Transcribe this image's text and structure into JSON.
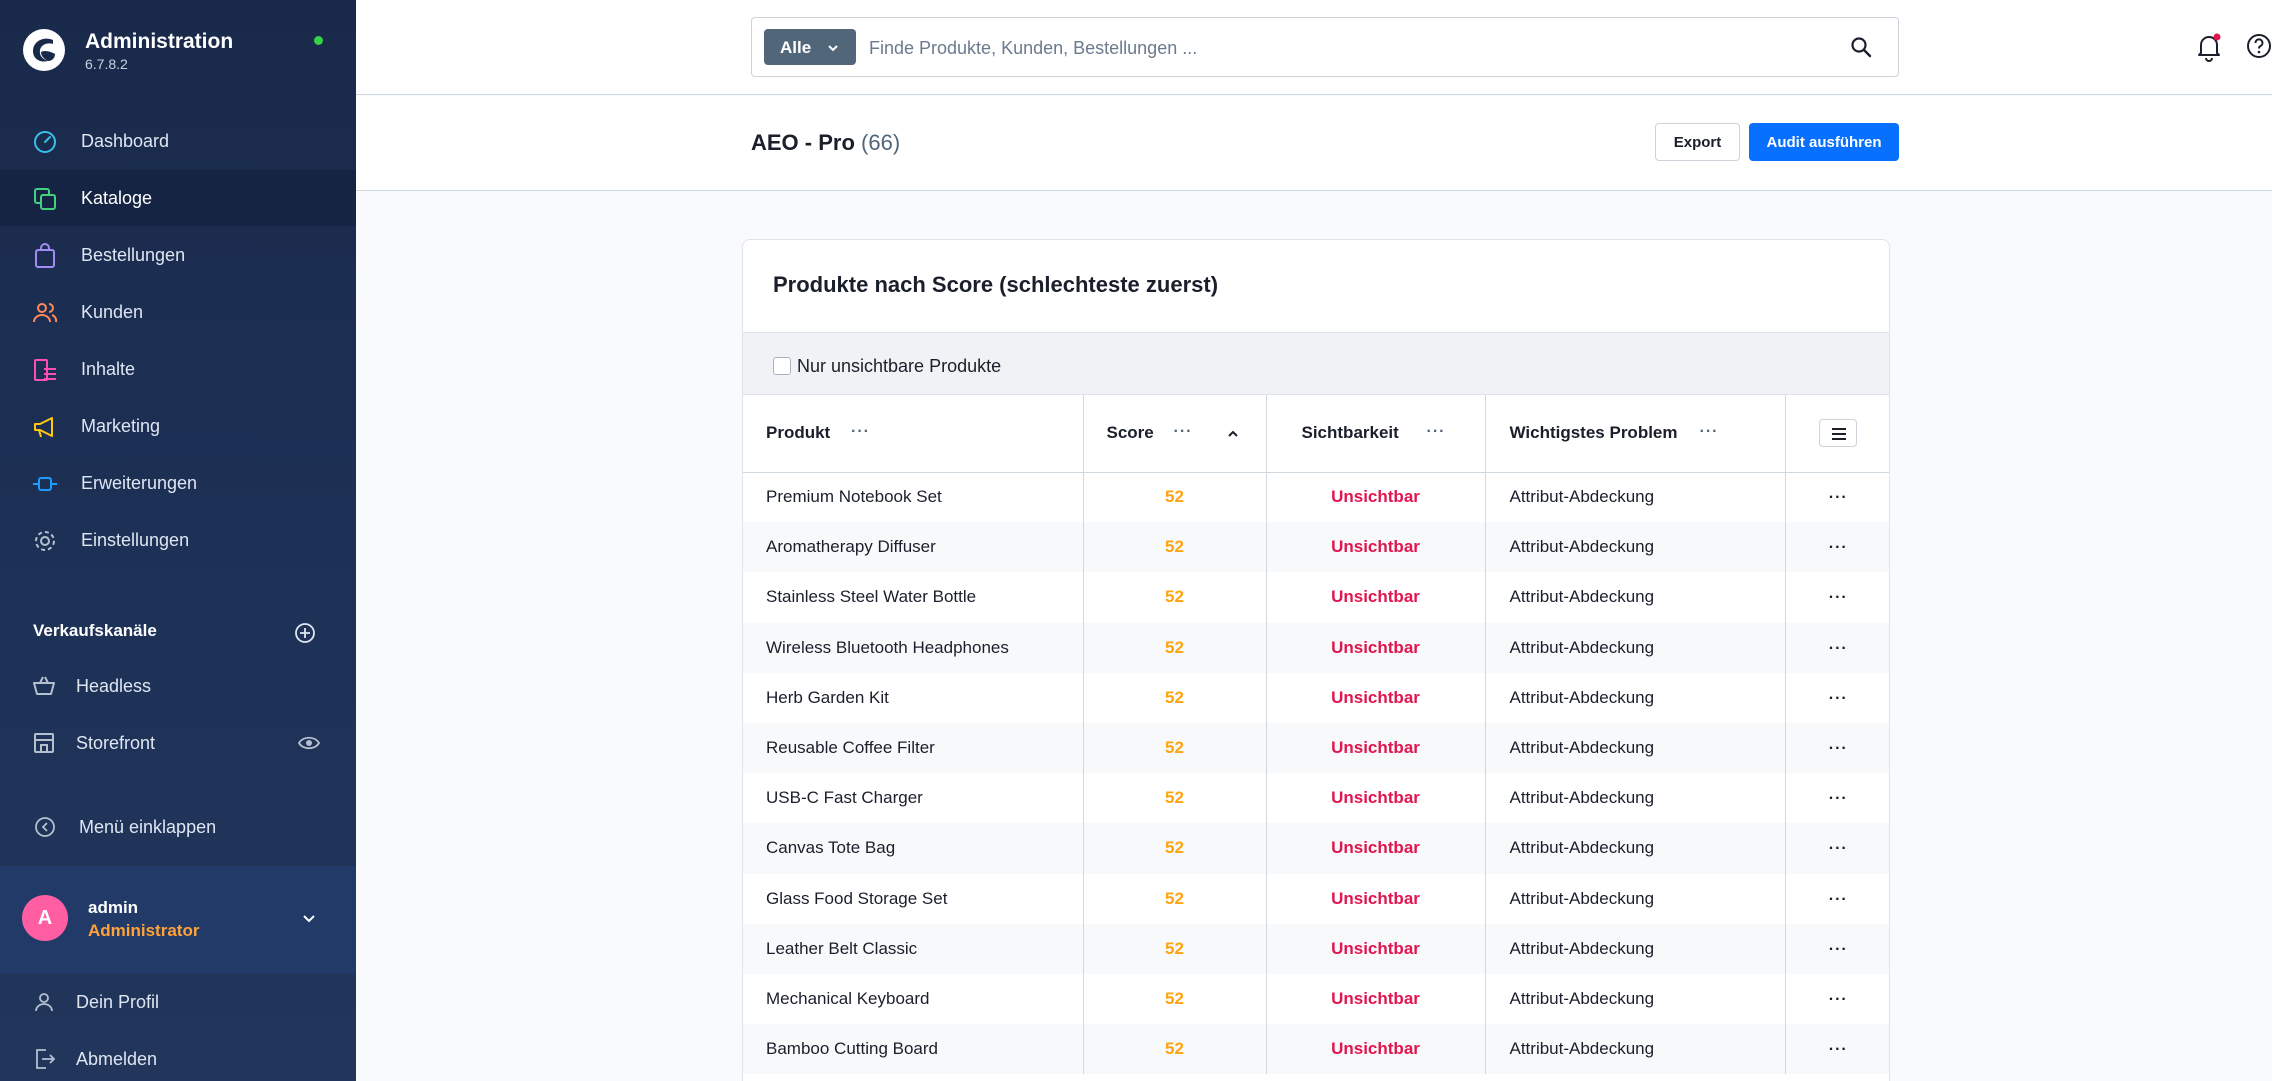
{
  "sidebar": {
    "title": "Administration",
    "version": "6.7.8.2",
    "status_color": "#37d046",
    "items": [
      {
        "label": "Dashboard",
        "icon": "gauge-icon",
        "color": "#38c0e8"
      },
      {
        "label": "Kataloge",
        "icon": "catalog-icon",
        "color": "#43d17f",
        "active": true
      },
      {
        "label": "Bestellungen",
        "icon": "shopping-bag-icon",
        "color": "#a08cf2"
      },
      {
        "label": "Kunden",
        "icon": "users-icon",
        "color": "#ff8a57"
      },
      {
        "label": "Inhalte",
        "icon": "content-icon",
        "color": "#ff4fb0"
      },
      {
        "label": "Marketing",
        "icon": "megaphone-icon",
        "color": "#ffc80a"
      },
      {
        "label": "Erweiterungen",
        "icon": "plug-icon",
        "color": "#199efe"
      },
      {
        "label": "Einstellungen",
        "icon": "gear-icon",
        "color": "#b5c0cf"
      }
    ],
    "channels_title": "Verkaufskanäle",
    "channels": [
      {
        "label": "Headless",
        "icon": "basket-icon"
      },
      {
        "label": "Storefront",
        "icon": "storefront-icon"
      }
    ],
    "collapse_label": "Menü einklappen",
    "user": {
      "initial": "A",
      "name": "admin",
      "role": "Administrator"
    },
    "profile_label": "Dein Profil",
    "logout_label": "Abmelden"
  },
  "search": {
    "type_label": "Alle",
    "placeholder": "Finde Produkte, Kunden, Bestellungen ..."
  },
  "header": {
    "title": "AEO - Pro",
    "count": "(66)",
    "export_label": "Export",
    "audit_label": "Audit ausführen"
  },
  "card": {
    "title": "Produkte nach Score (schlechteste zuerst)",
    "filter_label": "Nur unsichtbare Produkte",
    "columns": {
      "product": "Produkt",
      "score": "Score",
      "visibility": "Sichtbarkeit",
      "problem": "Wichtigstes Problem"
    },
    "rows": [
      {
        "product": "Premium Notebook Set",
        "score": "52",
        "visibility": "Unsichtbar",
        "problem": "Attribut-Abdeckung"
      },
      {
        "product": "Aromatherapy Diffuser",
        "score": "52",
        "visibility": "Unsichtbar",
        "problem": "Attribut-Abdeckung"
      },
      {
        "product": "Stainless Steel Water Bottle",
        "score": "52",
        "visibility": "Unsichtbar",
        "problem": "Attribut-Abdeckung"
      },
      {
        "product": "Wireless Bluetooth Headphones",
        "score": "52",
        "visibility": "Unsichtbar",
        "problem": "Attribut-Abdeckung"
      },
      {
        "product": "Herb Garden Kit",
        "score": "52",
        "visibility": "Unsichtbar",
        "problem": "Attribut-Abdeckung"
      },
      {
        "product": "Reusable Coffee Filter",
        "score": "52",
        "visibility": "Unsichtbar",
        "problem": "Attribut-Abdeckung"
      },
      {
        "product": "USB-C Fast Charger",
        "score": "52",
        "visibility": "Unsichtbar",
        "problem": "Attribut-Abdeckung"
      },
      {
        "product": "Canvas Tote Bag",
        "score": "52",
        "visibility": "Unsichtbar",
        "problem": "Attribut-Abdeckung"
      },
      {
        "product": "Glass Food Storage Set",
        "score": "52",
        "visibility": "Unsichtbar",
        "problem": "Attribut-Abdeckung"
      },
      {
        "product": "Leather Belt Classic",
        "score": "52",
        "visibility": "Unsichtbar",
        "problem": "Attribut-Abdeckung"
      },
      {
        "product": "Mechanical Keyboard",
        "score": "52",
        "visibility": "Unsichtbar",
        "problem": "Attribut-Abdeckung"
      },
      {
        "product": "Bamboo Cutting Board",
        "score": "52",
        "visibility": "Unsichtbar",
        "problem": "Attribut-Abdeckung"
      }
    ]
  }
}
